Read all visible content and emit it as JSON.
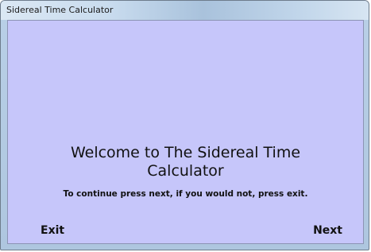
{
  "window": {
    "title": "Sidereal Time Calculator"
  },
  "main": {
    "welcome_line1": "Welcome to The Sidereal Time",
    "welcome_line2": "Calculator",
    "instructions": "To continue press next, if you would not, press exit."
  },
  "buttons": {
    "exit_label": "Exit",
    "next_label": "Next"
  },
  "colors": {
    "client_background": "#c6c6fa",
    "titlebar": "#c8dbee",
    "text": "#111111"
  }
}
